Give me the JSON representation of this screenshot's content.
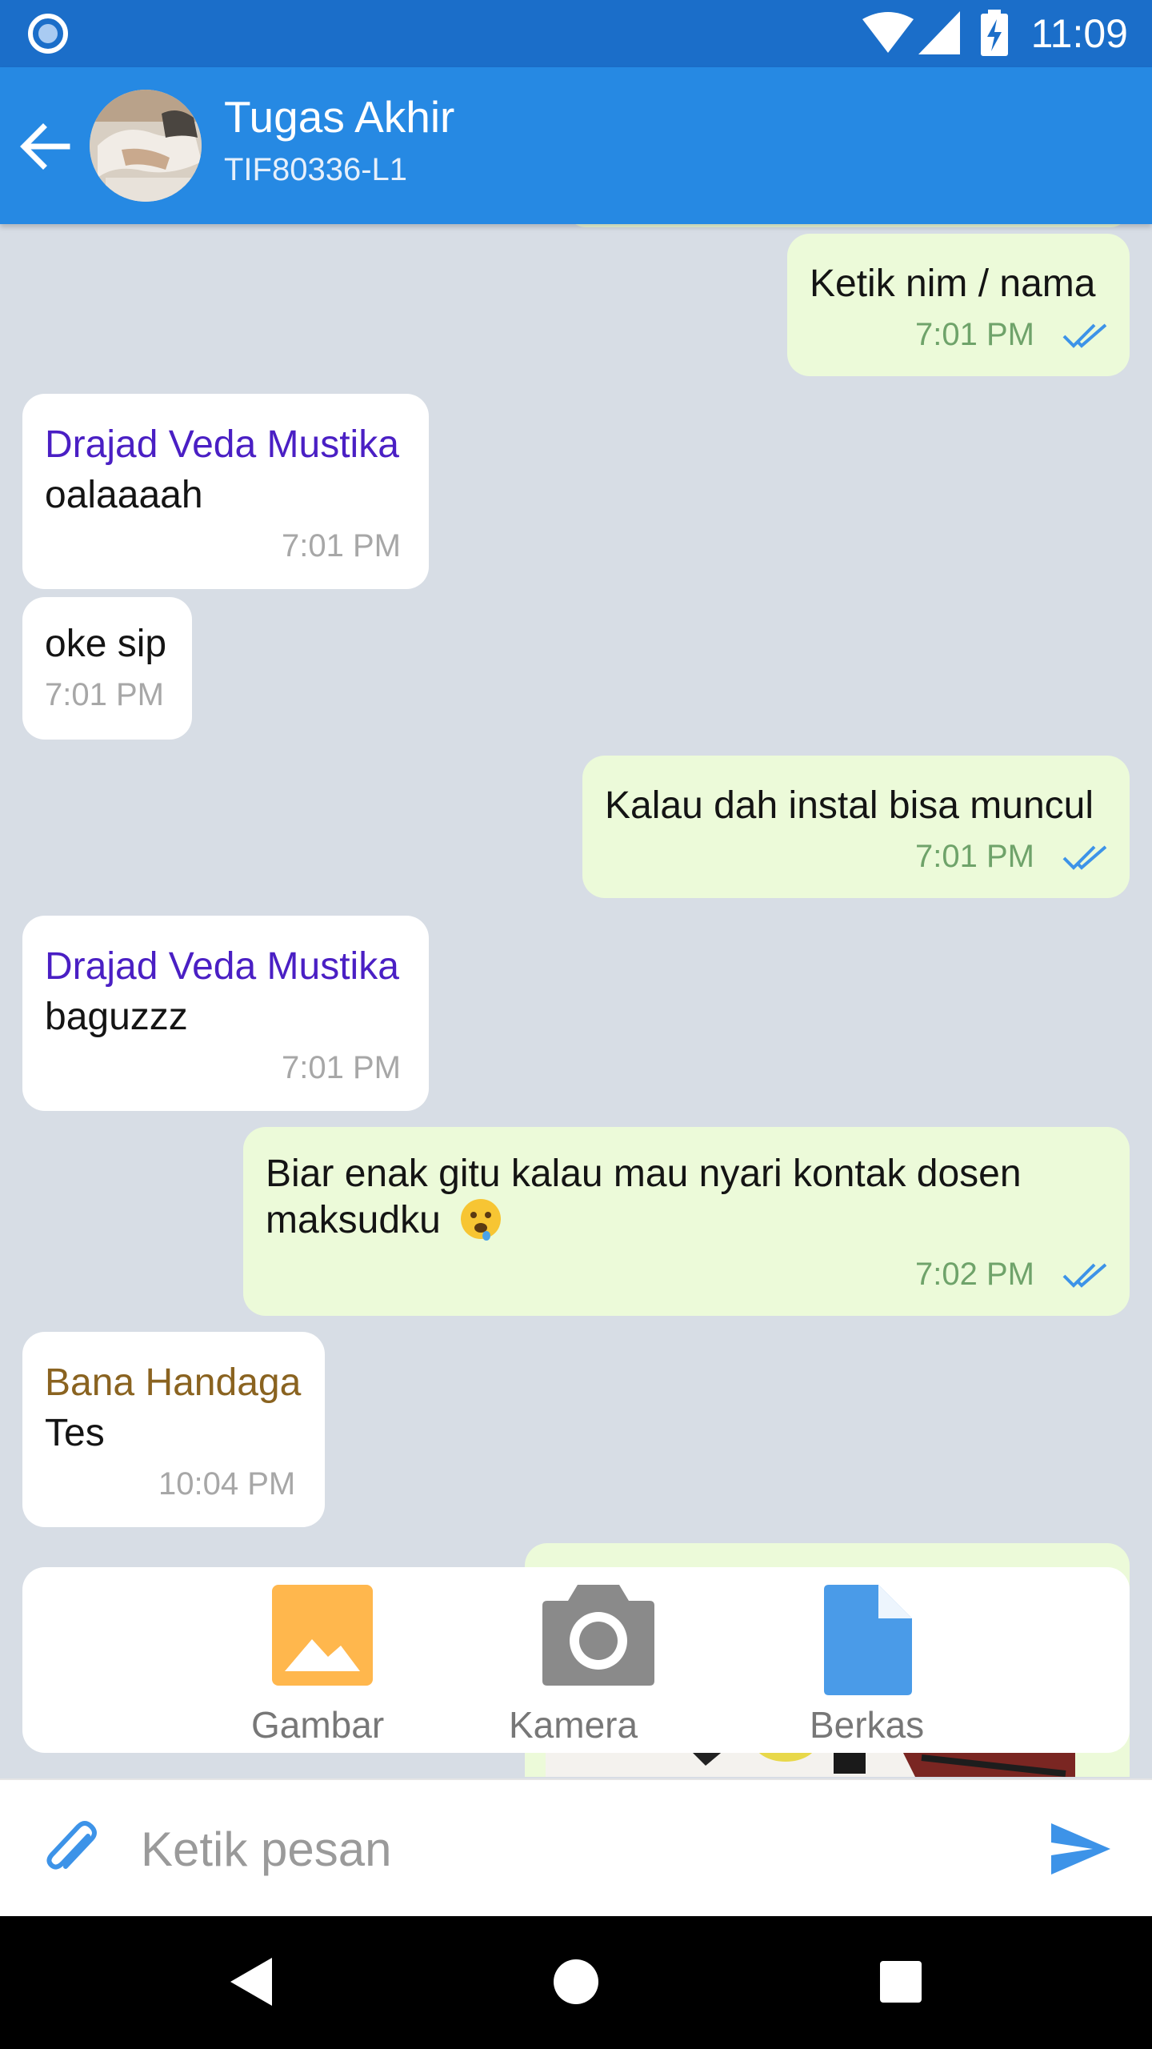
{
  "status_bar": {
    "time": "11:09"
  },
  "header": {
    "title": "Tugas Akhir",
    "subtitle": "TIF80336-L1"
  },
  "messages": [
    {
      "direction": "out",
      "text": "Ketik nim / nama",
      "time": "7:01 PM"
    },
    {
      "direction": "in",
      "sender": "Drajad Veda Mustika",
      "text": "oalaaaah",
      "time": "7:01 PM"
    },
    {
      "direction": "in",
      "text": "oke sip",
      "time": "7:01 PM"
    },
    {
      "direction": "out",
      "text": "Kalau dah instal bisa muncul",
      "time": "7:01 PM"
    },
    {
      "direction": "in",
      "sender": "Drajad Veda Mustika",
      "text": "baguzzz",
      "time": "7:01 PM"
    },
    {
      "direction": "out",
      "text": "Biar enak gitu kalau mau nyari kontak dosen",
      "text2": "maksudku",
      "time": "7:02 PM"
    },
    {
      "direction": "in",
      "sender": "Bana Handaga",
      "text": "Tes",
      "time": "10:04 PM"
    }
  ],
  "attach_menu": {
    "items": [
      {
        "label": "Gambar"
      },
      {
        "label": "Kamera"
      },
      {
        "label": "Berkas"
      }
    ]
  },
  "input": {
    "placeholder": "Ketik pesan"
  },
  "colors": {
    "status_bar": "#1b6ec9",
    "app_bar": "#2689e3",
    "chat_bg": "#d7dde5",
    "outgoing_bubble": "#ecfad9",
    "sender_drajad": "#4a1fc4",
    "sender_bana": "#8a6320",
    "read_ticks": "#3d93e8"
  },
  "icons": [
    "back-arrow-icon",
    "paperclip-icon",
    "send-icon",
    "image-icon",
    "camera-icon",
    "file-icon",
    "double-check-icon",
    "wifi-icon",
    "signal-icon",
    "battery-icon"
  ]
}
